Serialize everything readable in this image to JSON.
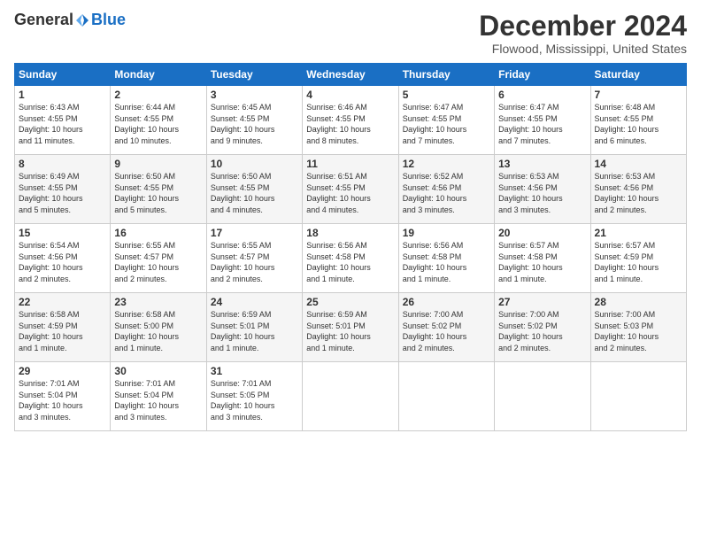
{
  "header": {
    "logo_general": "General",
    "logo_blue": "Blue",
    "month": "December 2024",
    "location": "Flowood, Mississippi, United States"
  },
  "days_of_week": [
    "Sunday",
    "Monday",
    "Tuesday",
    "Wednesday",
    "Thursday",
    "Friday",
    "Saturday"
  ],
  "weeks": [
    [
      {
        "day": 1,
        "info": "Sunrise: 6:43 AM\nSunset: 4:55 PM\nDaylight: 10 hours\nand 11 minutes."
      },
      {
        "day": 2,
        "info": "Sunrise: 6:44 AM\nSunset: 4:55 PM\nDaylight: 10 hours\nand 10 minutes."
      },
      {
        "day": 3,
        "info": "Sunrise: 6:45 AM\nSunset: 4:55 PM\nDaylight: 10 hours\nand 9 minutes."
      },
      {
        "day": 4,
        "info": "Sunrise: 6:46 AM\nSunset: 4:55 PM\nDaylight: 10 hours\nand 8 minutes."
      },
      {
        "day": 5,
        "info": "Sunrise: 6:47 AM\nSunset: 4:55 PM\nDaylight: 10 hours\nand 7 minutes."
      },
      {
        "day": 6,
        "info": "Sunrise: 6:47 AM\nSunset: 4:55 PM\nDaylight: 10 hours\nand 7 minutes."
      },
      {
        "day": 7,
        "info": "Sunrise: 6:48 AM\nSunset: 4:55 PM\nDaylight: 10 hours\nand 6 minutes."
      }
    ],
    [
      {
        "day": 8,
        "info": "Sunrise: 6:49 AM\nSunset: 4:55 PM\nDaylight: 10 hours\nand 5 minutes."
      },
      {
        "day": 9,
        "info": "Sunrise: 6:50 AM\nSunset: 4:55 PM\nDaylight: 10 hours\nand 5 minutes."
      },
      {
        "day": 10,
        "info": "Sunrise: 6:50 AM\nSunset: 4:55 PM\nDaylight: 10 hours\nand 4 minutes."
      },
      {
        "day": 11,
        "info": "Sunrise: 6:51 AM\nSunset: 4:55 PM\nDaylight: 10 hours\nand 4 minutes."
      },
      {
        "day": 12,
        "info": "Sunrise: 6:52 AM\nSunset: 4:56 PM\nDaylight: 10 hours\nand 3 minutes."
      },
      {
        "day": 13,
        "info": "Sunrise: 6:53 AM\nSunset: 4:56 PM\nDaylight: 10 hours\nand 3 minutes."
      },
      {
        "day": 14,
        "info": "Sunrise: 6:53 AM\nSunset: 4:56 PM\nDaylight: 10 hours\nand 2 minutes."
      }
    ],
    [
      {
        "day": 15,
        "info": "Sunrise: 6:54 AM\nSunset: 4:56 PM\nDaylight: 10 hours\nand 2 minutes."
      },
      {
        "day": 16,
        "info": "Sunrise: 6:55 AM\nSunset: 4:57 PM\nDaylight: 10 hours\nand 2 minutes."
      },
      {
        "day": 17,
        "info": "Sunrise: 6:55 AM\nSunset: 4:57 PM\nDaylight: 10 hours\nand 2 minutes."
      },
      {
        "day": 18,
        "info": "Sunrise: 6:56 AM\nSunset: 4:58 PM\nDaylight: 10 hours\nand 1 minute."
      },
      {
        "day": 19,
        "info": "Sunrise: 6:56 AM\nSunset: 4:58 PM\nDaylight: 10 hours\nand 1 minute."
      },
      {
        "day": 20,
        "info": "Sunrise: 6:57 AM\nSunset: 4:58 PM\nDaylight: 10 hours\nand 1 minute."
      },
      {
        "day": 21,
        "info": "Sunrise: 6:57 AM\nSunset: 4:59 PM\nDaylight: 10 hours\nand 1 minute."
      }
    ],
    [
      {
        "day": 22,
        "info": "Sunrise: 6:58 AM\nSunset: 4:59 PM\nDaylight: 10 hours\nand 1 minute."
      },
      {
        "day": 23,
        "info": "Sunrise: 6:58 AM\nSunset: 5:00 PM\nDaylight: 10 hours\nand 1 minute."
      },
      {
        "day": 24,
        "info": "Sunrise: 6:59 AM\nSunset: 5:01 PM\nDaylight: 10 hours\nand 1 minute."
      },
      {
        "day": 25,
        "info": "Sunrise: 6:59 AM\nSunset: 5:01 PM\nDaylight: 10 hours\nand 1 minute."
      },
      {
        "day": 26,
        "info": "Sunrise: 7:00 AM\nSunset: 5:02 PM\nDaylight: 10 hours\nand 2 minutes."
      },
      {
        "day": 27,
        "info": "Sunrise: 7:00 AM\nSunset: 5:02 PM\nDaylight: 10 hours\nand 2 minutes."
      },
      {
        "day": 28,
        "info": "Sunrise: 7:00 AM\nSunset: 5:03 PM\nDaylight: 10 hours\nand 2 minutes."
      }
    ],
    [
      {
        "day": 29,
        "info": "Sunrise: 7:01 AM\nSunset: 5:04 PM\nDaylight: 10 hours\nand 3 minutes."
      },
      {
        "day": 30,
        "info": "Sunrise: 7:01 AM\nSunset: 5:04 PM\nDaylight: 10 hours\nand 3 minutes."
      },
      {
        "day": 31,
        "info": "Sunrise: 7:01 AM\nSunset: 5:05 PM\nDaylight: 10 hours\nand 3 minutes."
      },
      null,
      null,
      null,
      null
    ]
  ]
}
